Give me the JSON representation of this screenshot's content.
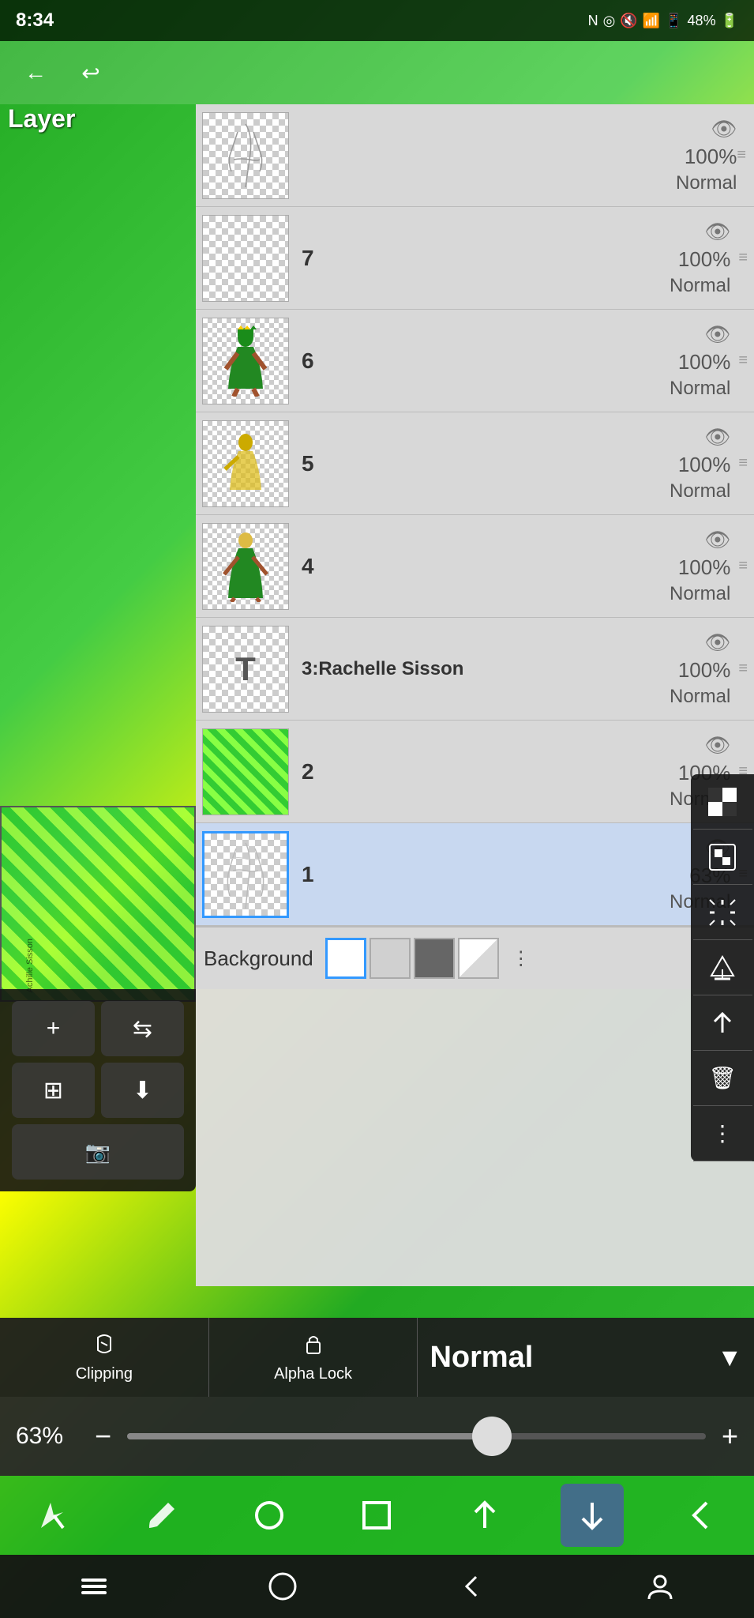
{
  "statusBar": {
    "time": "8:34",
    "batteryPct": "48%",
    "icons": [
      "N",
      "signal",
      "mute",
      "wifi",
      "cell",
      "battery"
    ]
  },
  "pageTitle": "Layer",
  "layers": [
    {
      "id": "top-partial",
      "number": "",
      "opacity": "100%",
      "blend": "Normal",
      "visible": true,
      "active": false,
      "type": "sketch"
    },
    {
      "id": "layer-7",
      "number": "7",
      "opacity": "100%",
      "blend": "Normal",
      "visible": true,
      "active": false,
      "type": "empty"
    },
    {
      "id": "layer-6",
      "number": "6",
      "opacity": "100%",
      "blend": "Normal",
      "visible": true,
      "active": false,
      "type": "figure-green"
    },
    {
      "id": "layer-5",
      "number": "5",
      "opacity": "100%",
      "blend": "Normal",
      "visible": true,
      "active": false,
      "type": "figure-yellow"
    },
    {
      "id": "layer-4",
      "number": "4",
      "opacity": "100%",
      "blend": "Normal",
      "visible": true,
      "active": false,
      "type": "figure-full"
    },
    {
      "id": "layer-3",
      "number": "3:Rachelle Sisson",
      "opacity": "100%",
      "blend": "Normal",
      "visible": true,
      "active": false,
      "type": "text"
    },
    {
      "id": "layer-2",
      "number": "2",
      "opacity": "100%",
      "blend": "Normal",
      "visible": true,
      "active": false,
      "type": "stripe"
    },
    {
      "id": "layer-1",
      "number": "1",
      "opacity": "63%",
      "blend": "Normal",
      "visible": true,
      "active": true,
      "type": "sketch-faint"
    }
  ],
  "background": {
    "label": "Background",
    "swatches": [
      "white",
      "light-gray",
      "dark-gray",
      "transparent"
    ]
  },
  "blendBar": {
    "clippingLabel": "Clipping",
    "alphaLockLabel": "Alpha Lock",
    "blendMode": "Normal"
  },
  "opacityBar": {
    "value": "63%",
    "sliderPosition": 63
  },
  "miniTools": {
    "buttons": [
      "+",
      "flip-h",
      "add-layer",
      "flatten"
    ]
  },
  "bottomTools": {
    "buttons": [
      "select-draw",
      "brush",
      "circle",
      "square",
      "up-arrow",
      "down-arrow",
      "back-arrow"
    ]
  },
  "navBar": {
    "buttons": [
      "menu",
      "home",
      "back",
      "person"
    ]
  }
}
